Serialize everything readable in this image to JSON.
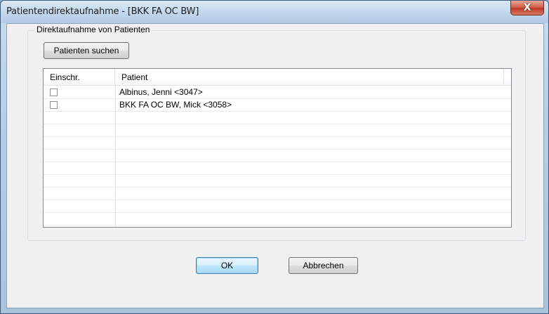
{
  "window": {
    "title": "Patientendirektaufnahme - [BKK FA OC BW]",
    "close_label": "X"
  },
  "group": {
    "legend": "Direktaufnahme von Patienten"
  },
  "buttons": {
    "search_label": "Patienten suchen",
    "ok_label": "OK",
    "cancel_label": "Abbrechen"
  },
  "table": {
    "columns": [
      "Einschr.",
      "Patient"
    ],
    "rows": [
      {
        "checked": false,
        "patient": "Albinus, Jenni <3047>"
      },
      {
        "checked": false,
        "patient": "BKK FA OC BW, Mick <3058>"
      }
    ]
  },
  "colors": {
    "accent": "#3c7fb1",
    "close_button": "#c0392b"
  }
}
